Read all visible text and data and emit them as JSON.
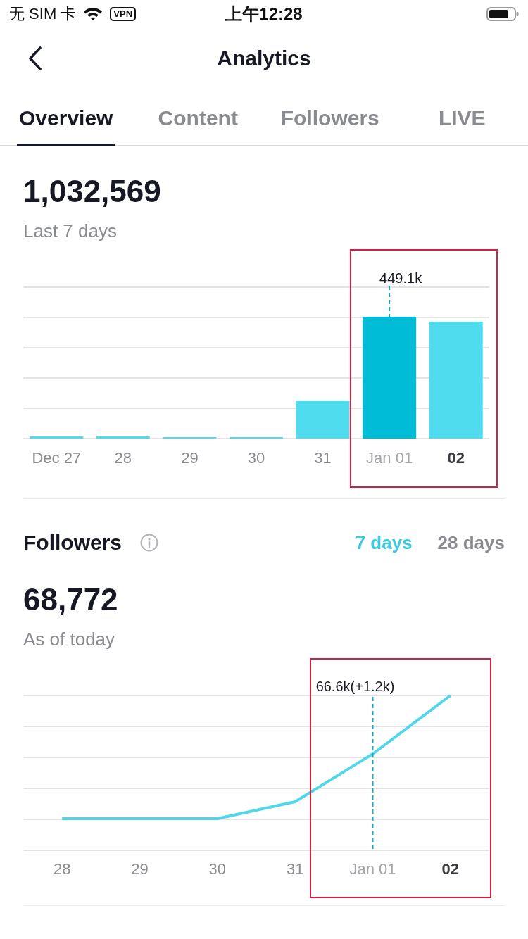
{
  "status_bar": {
    "carrier": "无 SIM 卡",
    "vpn": "VPN",
    "time": "上午12:28"
  },
  "header": {
    "title": "Analytics"
  },
  "tabs": [
    {
      "label": "Overview",
      "selected": true
    },
    {
      "label": "Content",
      "selected": false
    },
    {
      "label": "Followers",
      "selected": false
    },
    {
      "label": "LIVE",
      "selected": false
    }
  ],
  "views": {
    "total": "1,032,569",
    "period": "Last 7 days",
    "chart": {
      "tooltip": "449.1k",
      "frame": true,
      "days": [
        {
          "label": "Dec 27",
          "selected": false,
          "current": false
        },
        {
          "label": "28",
          "selected": false,
          "current": false
        },
        {
          "label": "29",
          "selected": false,
          "current": false
        },
        {
          "label": "30",
          "selected": false,
          "current": false
        },
        {
          "label": "31",
          "selected": false,
          "current": false
        },
        {
          "label": "Jan 01",
          "selected": true,
          "current": false
        },
        {
          "label": "02",
          "selected": false,
          "current": true
        }
      ]
    }
  },
  "followers": {
    "title": "Followers",
    "periods": [
      {
        "label": "7 days",
        "selected": true
      },
      {
        "label": "28 days",
        "selected": false
      }
    ],
    "total": "68,772",
    "caption": "As of today",
    "chart": {
      "tooltip": "66.6k(+1.2k)",
      "frame": true,
      "days": [
        {
          "label": "28",
          "selected": false,
          "current": false
        },
        {
          "label": "29",
          "selected": false,
          "current": false
        },
        {
          "label": "30",
          "selected": false,
          "current": false
        },
        {
          "label": "31",
          "selected": false,
          "current": false
        },
        {
          "label": "Jan 01",
          "selected": true,
          "current": false
        },
        {
          "label": "02",
          "selected": false,
          "current": true
        }
      ]
    }
  }
}
